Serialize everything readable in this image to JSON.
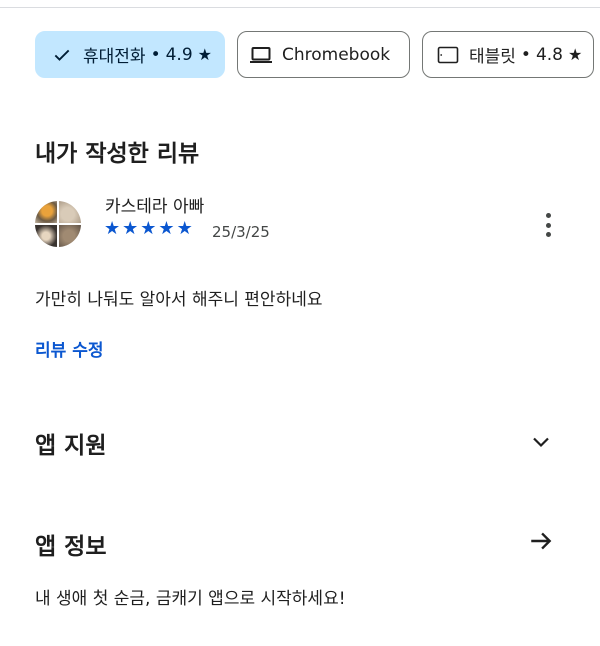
{
  "device_chips": [
    {
      "label": "휴대전화",
      "rating": "4.9",
      "icon": "check-icon",
      "selected": true
    },
    {
      "label": "Chromebook",
      "icon": "laptop-icon",
      "selected": false
    },
    {
      "label": "태블릿",
      "rating": "4.8",
      "icon": "tablet-icon",
      "selected": false
    }
  ],
  "chip_separator": "•",
  "star_glyph": "★",
  "my_review": {
    "heading": "내가 작성한 리뷰",
    "reviewer_name": "카스테라 아빠",
    "star_rating": 5,
    "date": "25/3/25",
    "text": "가만히 나둬도 알아서 해주니 편안하네요",
    "edit_label": "리뷰 수정"
  },
  "app_support": {
    "heading": "앱 지원"
  },
  "app_info": {
    "heading": "앱 정보",
    "description": "내 생애 첫 순금, 금캐기 앱으로 시작하세요!"
  },
  "colors": {
    "accent": "#0b57d0",
    "selected_chip_bg": "#c2e7ff",
    "text": "#1f1f1f",
    "divider": "#dadce0"
  }
}
